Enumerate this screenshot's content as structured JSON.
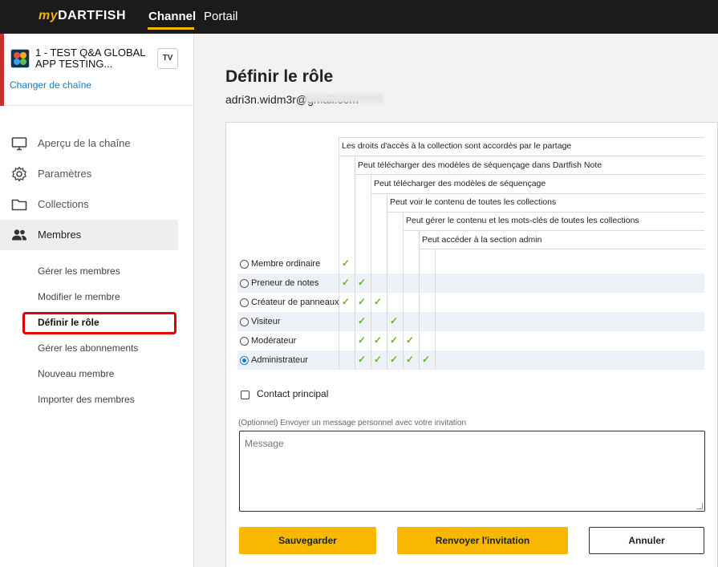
{
  "topbar": {
    "logo_my": "my",
    "logo_brand": "DARTFISH",
    "tabs": [
      {
        "label": "Channel",
        "active": true
      },
      {
        "label": "Portail",
        "active": false
      }
    ],
    "accent_color": "#f5b400"
  },
  "sidebar": {
    "channel": {
      "name": "1 - TEST Q&A GLOBAL APP TESTING...",
      "badge": "TV",
      "change_link": "Changer de chaîne"
    },
    "menu": [
      {
        "label": "Aperçu de la chaîne",
        "icon": "monitor-icon"
      },
      {
        "label": "Paramètres",
        "icon": "gear-icon"
      },
      {
        "label": "Collections",
        "icon": "folder-icon"
      },
      {
        "label": "Membres",
        "icon": "users-icon",
        "active": true
      }
    ],
    "submenu": [
      {
        "label": "Gérer les membres"
      },
      {
        "label": "Modifier le membre"
      },
      {
        "label": "Définir le rôle",
        "current": true
      },
      {
        "label": "Gérer les abonnements"
      },
      {
        "label": "Nouveau membre"
      },
      {
        "label": "Importer des membres"
      }
    ]
  },
  "main": {
    "title": "Définir le rôle",
    "email": "adri3n.widm3r@gmail.com",
    "permissions": [
      "Les droits d'accès à la collection sont accordés par le partage",
      "Peut télécharger des modèles de séquençage dans Dartfish Note",
      "Peut télécharger des modèles de séquençage",
      "Peut voir le contenu de toutes les collections",
      "Peut gérer le contenu et les mots-clés de toutes les collections",
      "Peut accéder à la section admin"
    ],
    "roles": [
      {
        "label": "Membre ordinaire",
        "checks": [
          1,
          0,
          0,
          0,
          0,
          0
        ],
        "selected": false
      },
      {
        "label": "Preneur de notes",
        "checks": [
          1,
          1,
          0,
          0,
          0,
          0
        ],
        "selected": false
      },
      {
        "label": "Créateur de panneaux",
        "checks": [
          1,
          1,
          1,
          0,
          0,
          0
        ],
        "selected": false
      },
      {
        "label": "Visiteur",
        "checks": [
          0,
          1,
          0,
          1,
          0,
          0
        ],
        "selected": false
      },
      {
        "label": "Modérateur",
        "checks": [
          0,
          1,
          1,
          1,
          1,
          0
        ],
        "selected": false
      },
      {
        "label": "Administrateur",
        "checks": [
          0,
          1,
          1,
          1,
          1,
          1
        ],
        "selected": true
      }
    ],
    "check_glyph": "✓",
    "contact_label": "Contact principal",
    "message_hint": "(Optionnel) Envoyer un message personnel avec votre invitation",
    "message_placeholder": "Message",
    "buttons": {
      "save": "Sauvegarder",
      "resend": "Renvoyer l'invitation",
      "cancel": "Annuler"
    }
  }
}
